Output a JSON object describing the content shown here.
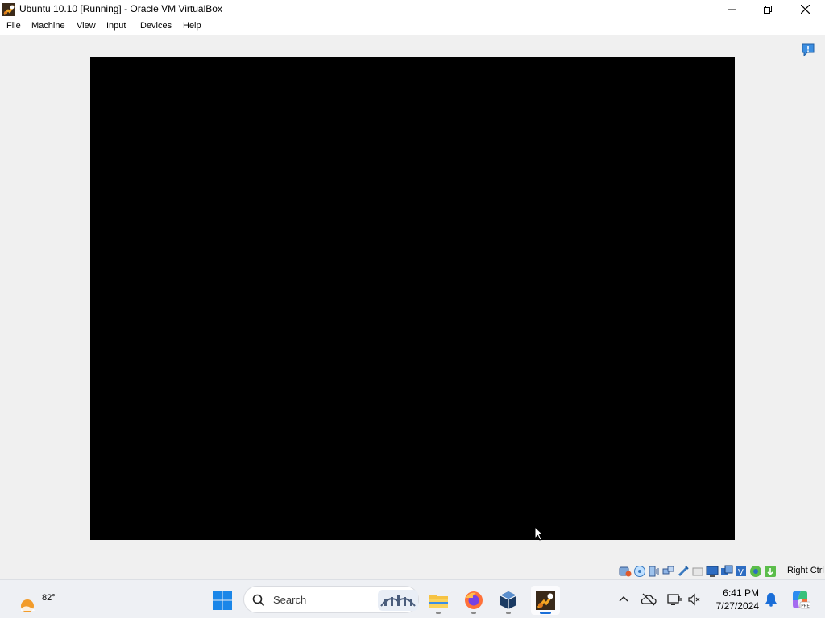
{
  "window": {
    "title": "Ubuntu 10.10 [Running] - Oracle VM VirtualBox",
    "icons": {
      "app": "virtualbox-vm-icon",
      "minimize": "minimize-icon",
      "maximize": "maximize-icon",
      "close": "close-icon"
    }
  },
  "menubar": {
    "items": [
      "File",
      "Machine",
      "View",
      "Input",
      "Devices",
      "Help"
    ]
  },
  "vm": {
    "screen_color": "#000000",
    "notification_icon": "notification-info-icon"
  },
  "statusbar": {
    "icons": [
      "storage-icon",
      "optical-drive-icon",
      "audio-icon",
      "network-icon",
      "usb-icon",
      "shared-folders-icon",
      "display-icon",
      "recording-icon",
      "cpu-icon",
      "guest-additions-icon",
      "mouse-integration-icon"
    ],
    "host_key": "Right Ctrl"
  },
  "taskbar": {
    "weather": {
      "temp": "82°",
      "icon": "weather-sun-icon"
    },
    "search": {
      "placeholder": "Search"
    },
    "apps": [
      "file-explorer-icon",
      "firefox-icon",
      "virtualbox-manager-icon",
      "virtualbox-vm-icon"
    ],
    "tray": {
      "chevron": "show-hidden-icons-icon",
      "cloud": "onedrive-offline-icon",
      "network": "network-icon",
      "volume": "volume-icon"
    },
    "clock": {
      "time": "6:41 PM",
      "date": "7/27/2024"
    },
    "accent_color": "#1a6ed8"
  }
}
